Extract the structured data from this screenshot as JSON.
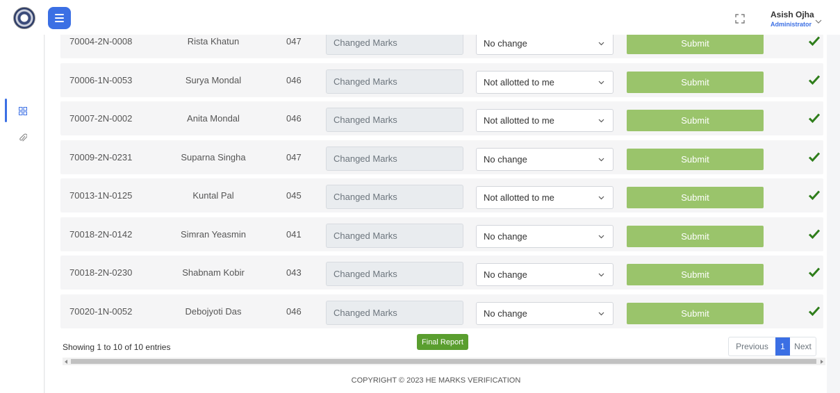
{
  "header": {
    "user_name": "Asish Ojha",
    "user_role": "Administrator",
    "icons": [
      "logo",
      "menu-icon",
      "fullscreen-icon",
      "chevron-down-icon"
    ]
  },
  "sidebar": {
    "icons": [
      "dashboard-grid-icon",
      "paperclip-icon"
    ],
    "active_index": 0,
    "accent": "#3b6fe4"
  },
  "table": {
    "marks_placeholder": "Changed Marks",
    "submit_label": "Submit",
    "submit_color": "#9ac46b",
    "check_color": "#2e7d1a",
    "rows": [
      {
        "roll": "70004-2N-0008",
        "name": "Rista Khatun",
        "code": "047",
        "status": "No change"
      },
      {
        "roll": "70006-1N-0053",
        "name": "Surya Mondal",
        "code": "046",
        "status": "Not allotted to me"
      },
      {
        "roll": "70007-2N-0002",
        "name": "Anita Mondal",
        "code": "046",
        "status": "Not allotted to me"
      },
      {
        "roll": "70009-2N-0231",
        "name": "Suparna Singha",
        "code": "047",
        "status": "No change"
      },
      {
        "roll": "70013-1N-0125",
        "name": "Kuntal Pal",
        "code": "045",
        "status": "Not allotted to me"
      },
      {
        "roll": "70018-2N-0142",
        "name": "Simran Yeasmin",
        "code": "041",
        "status": "No change"
      },
      {
        "roll": "70018-2N-0230",
        "name": "Shabnam Kobir",
        "code": "043",
        "status": "No change"
      },
      {
        "roll": "70020-1N-0052",
        "name": "Debojyoti Das",
        "code": "046",
        "status": "No change"
      }
    ]
  },
  "summary": {
    "showing": "Showing 1 to 10 of 10 entries",
    "final_report": "Final Report"
  },
  "pagination": {
    "previous": "Previous",
    "current": "1",
    "next": "Next"
  },
  "footer": {
    "copyright": "COPYRIGHT © 2023 HE MARKS VERIFICATION"
  }
}
